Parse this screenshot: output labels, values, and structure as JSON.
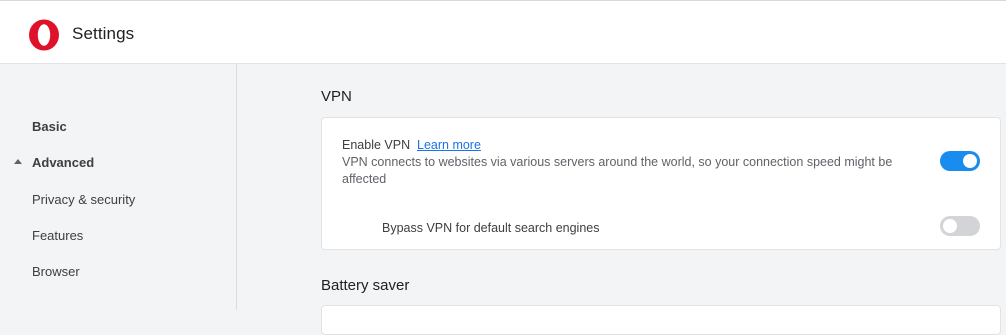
{
  "header": {
    "title": "Settings",
    "logo_icon": "opera-logo-icon",
    "logo_color": "#e0112b"
  },
  "sidebar": {
    "items": [
      {
        "label": "Basic"
      },
      {
        "label": "Advanced",
        "expanded": true,
        "icon": "caret-up-icon"
      },
      {
        "label": "Privacy & security"
      },
      {
        "label": "Features"
      },
      {
        "label": "Browser"
      }
    ]
  },
  "main": {
    "vpn": {
      "title": "VPN",
      "enable_label": "Enable VPN",
      "learn_more": "Learn more",
      "description": "VPN connects to websites via various servers around the world, so your connection speed might be affected",
      "enable_toggle_on": true,
      "bypass_label": "Bypass VPN for default search engines",
      "bypass_toggle_on": false
    },
    "battery": {
      "title": "Battery saver"
    }
  },
  "colors": {
    "accent": "#1a8cf0",
    "link": "#1a73e8",
    "toggle_off": "#d3d4d8"
  }
}
